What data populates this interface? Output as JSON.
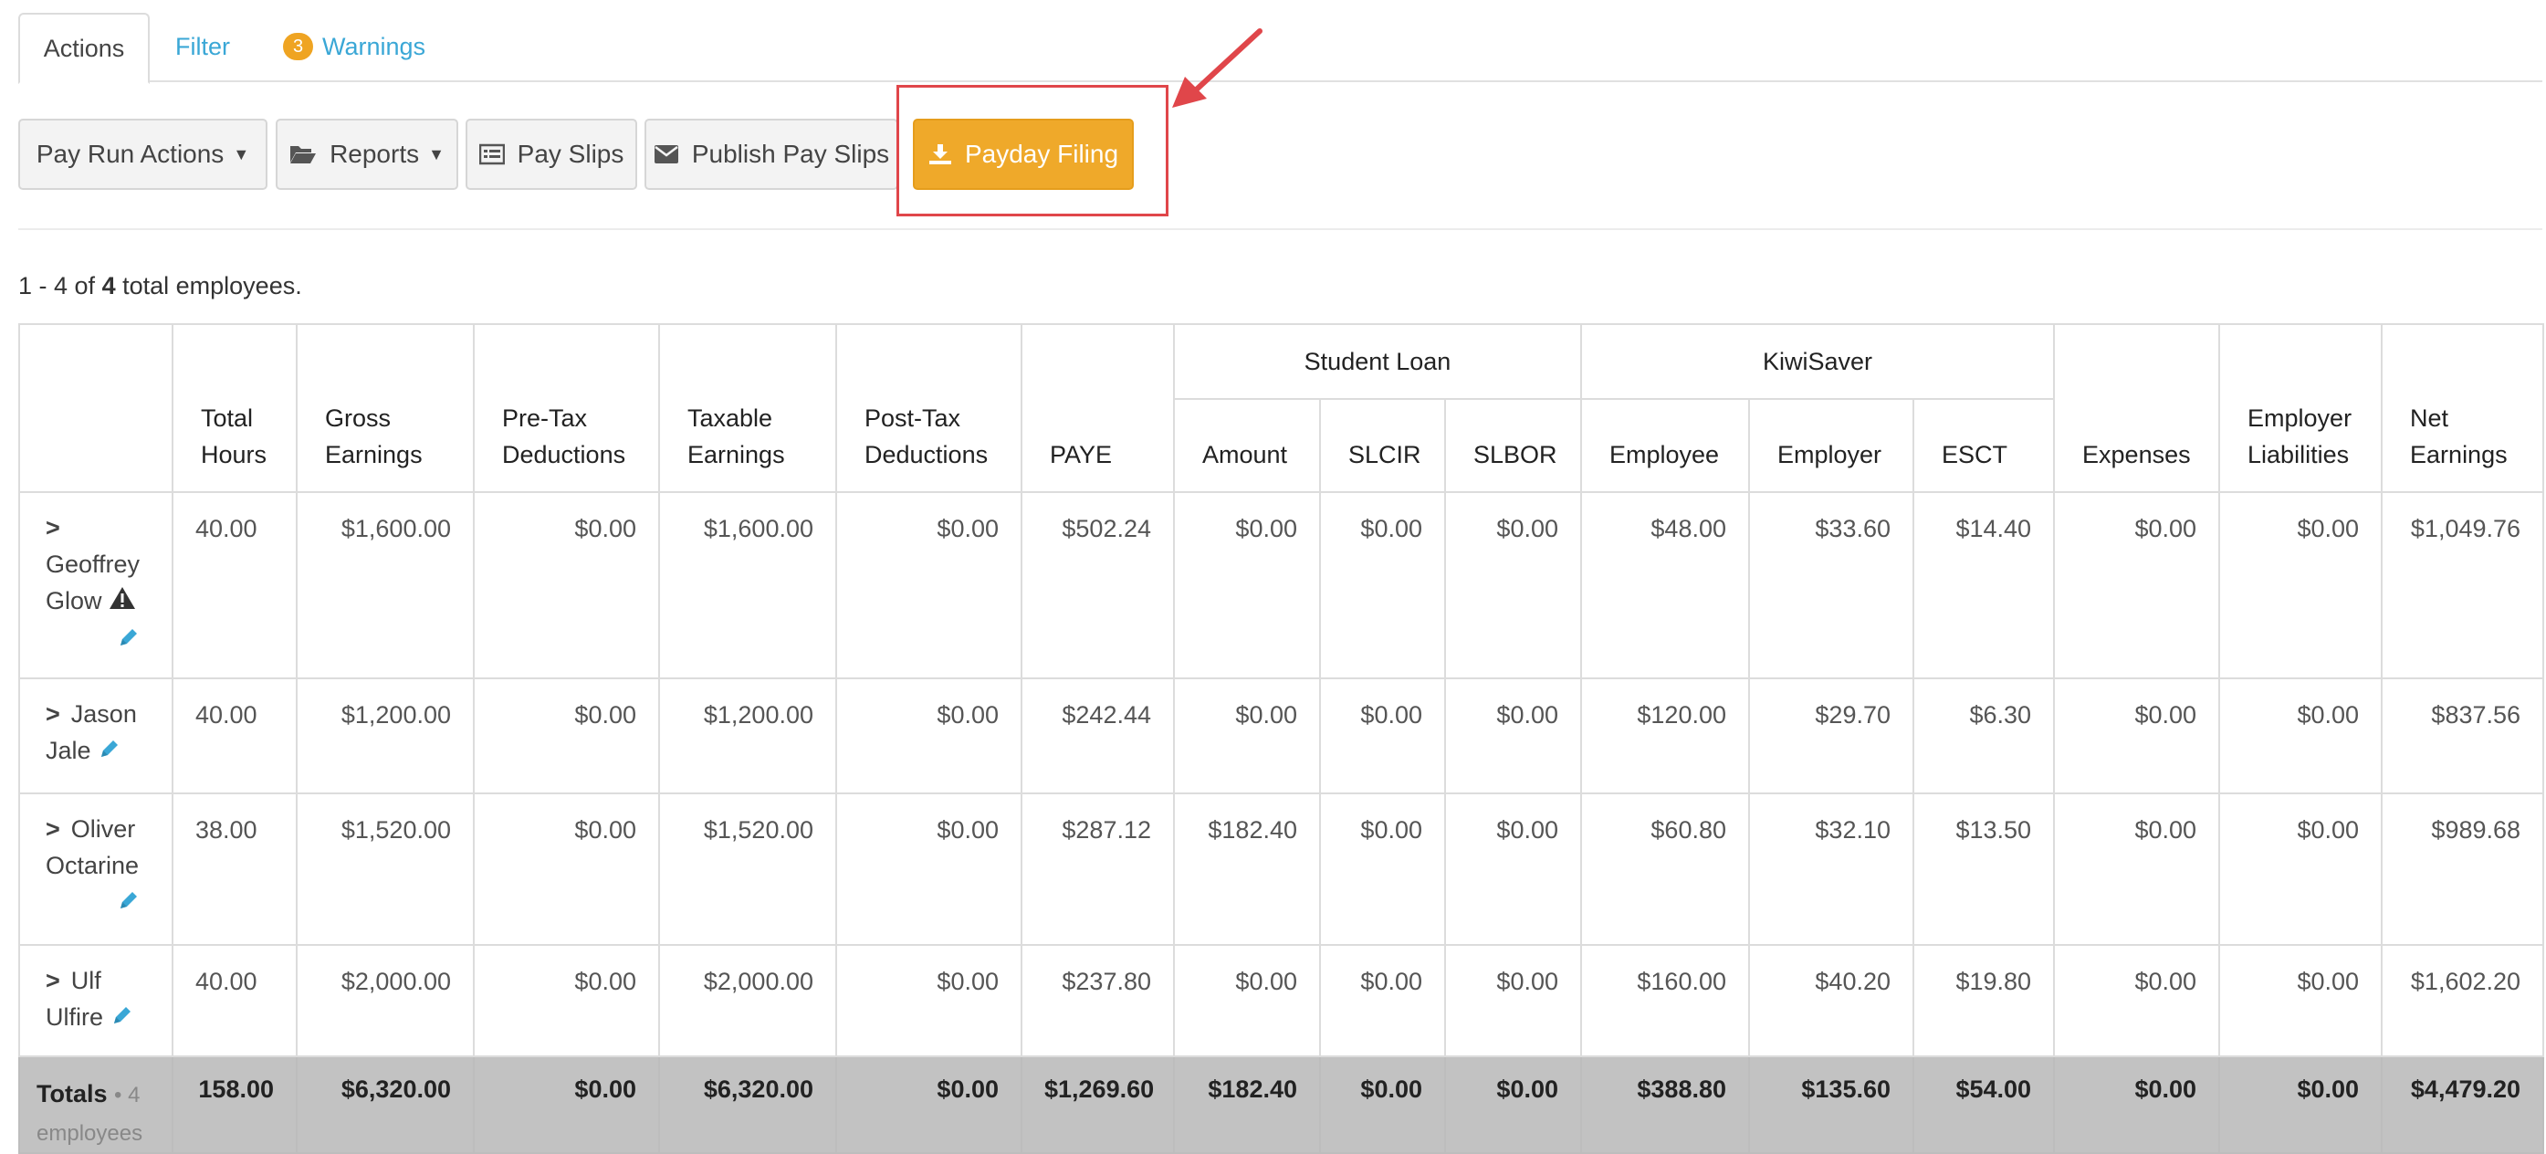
{
  "tabs": {
    "actions": "Actions",
    "filter": "Filter",
    "warnings": "Warnings",
    "warnings_count": "3"
  },
  "toolbar": {
    "pay_run_actions": "Pay Run Actions",
    "reports": "Reports",
    "pay_slips": "Pay Slips",
    "publish_pay_slips": "Publish Pay Slips",
    "payday_filing": "Payday Filing"
  },
  "summary": {
    "range": "1 - 4 of",
    "total": "4",
    "suffix": "total employees."
  },
  "table": {
    "headers": {
      "total_hours": [
        "Total",
        "Hours"
      ],
      "gross_earnings": [
        "Gross",
        "Earnings"
      ],
      "pre_tax": [
        "Pre-Tax",
        "Deductions"
      ],
      "taxable": [
        "Taxable",
        "Earnings"
      ],
      "post_tax": [
        "Post-Tax",
        "Deductions"
      ],
      "paye": "PAYE",
      "student_loan": "Student Loan",
      "amount": "Amount",
      "slcir": "SLCIR",
      "slbor": "SLBOR",
      "kiwisaver": "KiwiSaver",
      "employee": "Employee",
      "employer": "Employer",
      "esct": "ESCT",
      "expenses": "Expenses",
      "employer_liabilities": [
        "Employer",
        "Liabilities"
      ],
      "net_earnings": [
        "Net",
        "Earnings"
      ]
    },
    "rows": [
      {
        "name_lines": [
          "Geoffrey",
          "Glow"
        ],
        "warning": true,
        "hours": "40.00",
        "gross": "$1,600.00",
        "pre_tax": "$0.00",
        "taxable": "$1,600.00",
        "post_tax": "$0.00",
        "paye": "$502.24",
        "amount": "$0.00",
        "slcir": "$0.00",
        "slbor": "$0.00",
        "ks_employee": "$48.00",
        "ks_employer": "$33.60",
        "esct": "$14.40",
        "expenses": "$0.00",
        "liabilities": "$0.00",
        "net": "$1,049.76"
      },
      {
        "name_lines": [
          "Jason",
          "Jale"
        ],
        "warning": false,
        "hours": "40.00",
        "gross": "$1,200.00",
        "pre_tax": "$0.00",
        "taxable": "$1,200.00",
        "post_tax": "$0.00",
        "paye": "$242.44",
        "amount": "$0.00",
        "slcir": "$0.00",
        "slbor": "$0.00",
        "ks_employee": "$120.00",
        "ks_employer": "$29.70",
        "esct": "$6.30",
        "expenses": "$0.00",
        "liabilities": "$0.00",
        "net": "$837.56"
      },
      {
        "name_lines": [
          "Oliver",
          "Octarine"
        ],
        "warning": false,
        "hours": "38.00",
        "gross": "$1,520.00",
        "pre_tax": "$0.00",
        "taxable": "$1,520.00",
        "post_tax": "$0.00",
        "paye": "$287.12",
        "amount": "$182.40",
        "slcir": "$0.00",
        "slbor": "$0.00",
        "ks_employee": "$60.80",
        "ks_employer": "$32.10",
        "esct": "$13.50",
        "expenses": "$0.00",
        "liabilities": "$0.00",
        "net": "$989.68"
      },
      {
        "name_lines": [
          "Ulf",
          "Ulfire"
        ],
        "warning": false,
        "hours": "40.00",
        "gross": "$2,000.00",
        "pre_tax": "$0.00",
        "taxable": "$2,000.00",
        "post_tax": "$0.00",
        "paye": "$237.80",
        "amount": "$0.00",
        "slcir": "$0.00",
        "slbor": "$0.00",
        "ks_employee": "$160.00",
        "ks_employer": "$40.20",
        "esct": "$19.80",
        "expenses": "$0.00",
        "liabilities": "$0.00",
        "net": "$1,602.20"
      }
    ],
    "totals": {
      "label": "Totals",
      "sub": "• 4",
      "sub2": "employees",
      "hours": "158.00",
      "gross": "$6,320.00",
      "pre_tax": "$0.00",
      "taxable": "$6,320.00",
      "post_tax": "$0.00",
      "paye": "$1,269.60",
      "amount": "$182.40",
      "slcir": "$0.00",
      "slbor": "$0.00",
      "ks_employee": "$388.80",
      "ks_employer": "$135.60",
      "esct": "$54.00",
      "expenses": "$0.00",
      "liabilities": "$0.00",
      "net": "$4,479.20"
    }
  },
  "colors": {
    "accent_link": "#3aa7d6",
    "primary_button": "#efa92a",
    "highlight_box": "#e0464a",
    "totals_bg": "#c2c2c2"
  },
  "icons": {
    "reports": "folder-open-icon",
    "pay_slips": "list-icon",
    "publish": "envelope-icon",
    "payday": "download-icon",
    "expand": "chevron-right-icon",
    "edit": "pencil-icon",
    "warning": "warning-triangle-icon"
  }
}
